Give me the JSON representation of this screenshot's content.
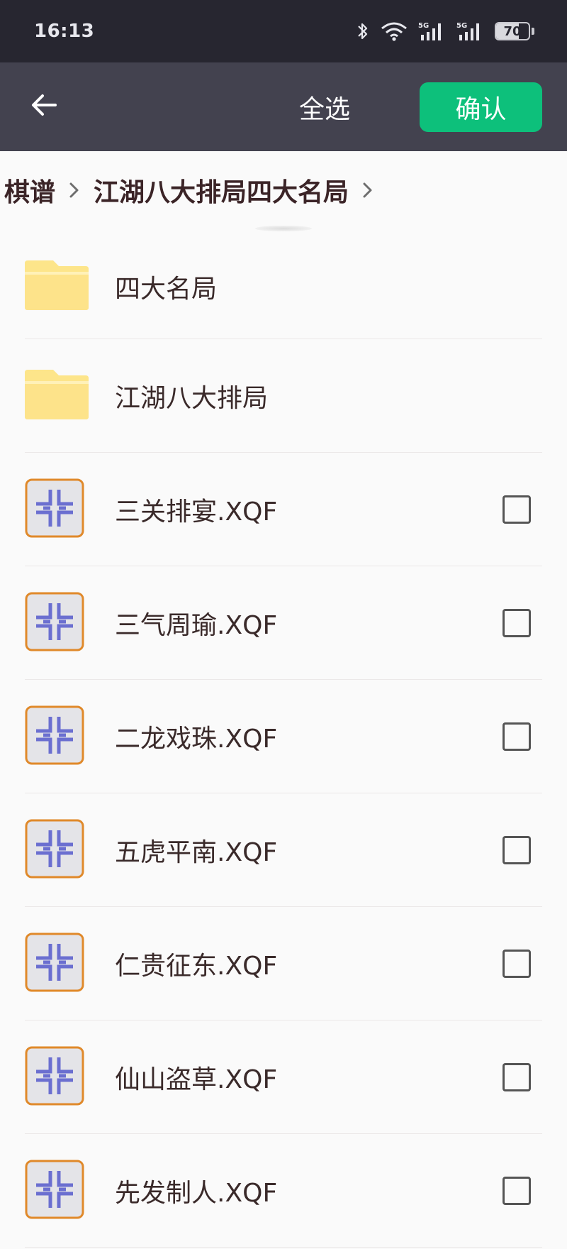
{
  "status_bar": {
    "time": "16:13",
    "battery": "70",
    "battery_level_percent": 70,
    "icons": [
      "bluetooth-icon",
      "wifi-icon",
      "signal-5g-icon",
      "signal-5g-icon",
      "battery-icon"
    ]
  },
  "app_bar": {
    "back_icon": "arrow-left-icon",
    "select_all": "全选",
    "confirm": "确认"
  },
  "breadcrumb": {
    "items": [
      "棋谱",
      "江湖八大排局四大名局"
    ],
    "separator_icon": "chevron-right-icon"
  },
  "folders": [
    {
      "name": "四大名局",
      "icon": "folder-icon"
    },
    {
      "name": "江湖八大排局",
      "icon": "folder-icon"
    }
  ],
  "files": [
    {
      "name": "三关排宴.XQF",
      "icon": "xqf-file-icon",
      "checked": false
    },
    {
      "name": "三气周瑜.XQF",
      "icon": "xqf-file-icon",
      "checked": false
    },
    {
      "name": "二龙戏珠.XQF",
      "icon": "xqf-file-icon",
      "checked": false
    },
    {
      "name": "五虎平南.XQF",
      "icon": "xqf-file-icon",
      "checked": false
    },
    {
      "name": "仁贵征东.XQF",
      "icon": "xqf-file-icon",
      "checked": false
    },
    {
      "name": "仙山盗草.XQF",
      "icon": "xqf-file-icon",
      "checked": false
    },
    {
      "name": "先发制人.XQF",
      "icon": "xqf-file-icon",
      "checked": false
    }
  ],
  "colors": {
    "status_bar_bg": "#272630",
    "app_bar_bg": "#43424f",
    "confirm_bg": "#0dc07b",
    "folder": "#fde58a",
    "file_icon_border": "#e0892a",
    "file_icon_glyph": "#6b6fd0"
  }
}
